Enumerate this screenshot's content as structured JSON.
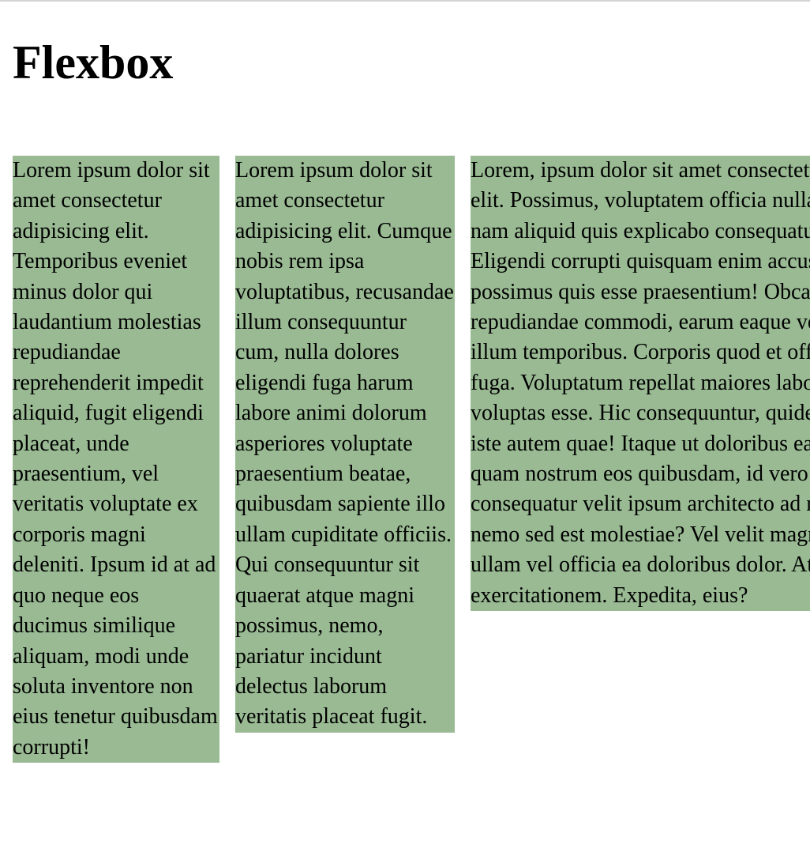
{
  "page": {
    "title": "Flexbox"
  },
  "flex_items": [
    {
      "text": "Lorem ipsum dolor sit amet consectetur adipisicing elit. Temporibus eveniet minus dolor qui laudantium molestias repudiandae reprehenderit impedit aliquid, fugit eligendi placeat, unde praesentium, vel veritatis voluptate ex corporis magni deleniti. Ipsum id at ad quo neque eos ducimus similique aliquam, modi unde soluta inventore non eius tenetur quibusdam corrupti!"
    },
    {
      "text": "Lorem ipsum dolor sit amet consectetur adipisicing elit. Cumque nobis rem ipsa voluptatibus, recusandae illum consequuntur cum, nulla dolores eligendi fuga harum labore animi dolorum asperiores voluptate praesentium beatae, quibusdam sapiente illo ullam cupiditate officiis. Qui consequuntur sit quaerat atque magni possimus, nemo, pariatur incidunt delectus laborum veritatis placeat fugit."
    },
    {
      "text": "Lorem, ipsum dolor sit amet consectetur adipisicing elit. Possimus, voluptatem officia nulla minus, sunt nam aliquid quis explicabo consequatur beatae. Eligendi corrupti quisquam enim accusantium possimus quis esse praesentium! Obcaecati repudiandae commodi, earum eaque velit voluptas illum temporibus. Corporis quod et officia, optio eos fuga. Voluptatum repellat maiores laborum rem voluptas esse. Hic consequuntur, quidem nobis suscipit iste autem quae! Itaque ut doloribus eaque quidem quam nostrum eos quibusdam, id vero optio consequatur velit ipsum architecto ad maiores aperiam nemo sed est molestiae? Vel velit magnam assumenda ullam vel officia ea doloribus dolor. Atque, exercitationem. Expedita, eius?"
    }
  ],
  "colors": {
    "item_background": "#99ba93",
    "page_background": "#ffffff",
    "text": "#000000"
  }
}
